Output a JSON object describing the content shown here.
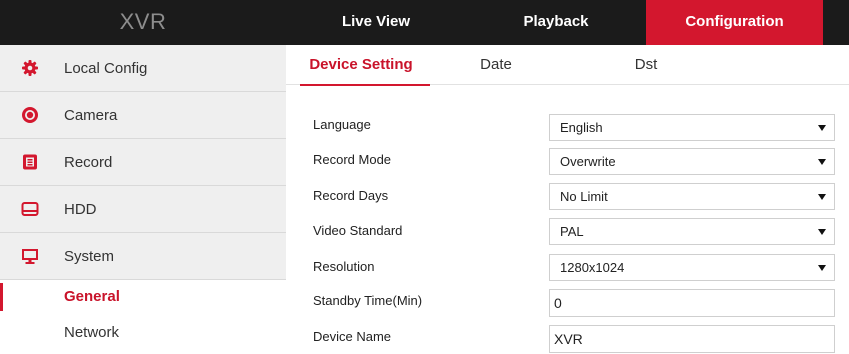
{
  "app": {
    "logo": "XVR"
  },
  "topnav": {
    "live_view": "Live View",
    "playback": "Playback",
    "configuration": "Configuration"
  },
  "colors": {
    "accent": "#d3172e",
    "topbar_bg": "#1b1b1b",
    "sidebar_bg": "#efefef"
  },
  "sidebar": {
    "items": [
      {
        "label": "Local Config",
        "icon": "gear-icon"
      },
      {
        "label": "Camera",
        "icon": "camera-icon"
      },
      {
        "label": "Record",
        "icon": "record-icon"
      },
      {
        "label": "HDD",
        "icon": "hdd-icon"
      },
      {
        "label": "System",
        "icon": "monitor-icon"
      }
    ],
    "subitems": [
      {
        "label": "General",
        "active": true
      },
      {
        "label": "Network",
        "active": false
      }
    ]
  },
  "tabs": [
    {
      "label": "Device Setting",
      "active": true
    },
    {
      "label": "Date",
      "active": false
    },
    {
      "label": "Dst",
      "active": false
    }
  ],
  "form": {
    "fields": [
      {
        "label": "Language",
        "value": "English",
        "type": "select"
      },
      {
        "label": "Record Mode",
        "value": "Overwrite",
        "type": "select"
      },
      {
        "label": "Record Days",
        "value": "No Limit",
        "type": "select"
      },
      {
        "label": "Video Standard",
        "value": "PAL",
        "type": "select"
      },
      {
        "label": "Resolution",
        "value": "1280x1024",
        "type": "select"
      },
      {
        "label": "Standby Time(Min)",
        "value": "0",
        "type": "text"
      },
      {
        "label": "Device Name",
        "value": "XVR",
        "type": "text"
      }
    ]
  }
}
